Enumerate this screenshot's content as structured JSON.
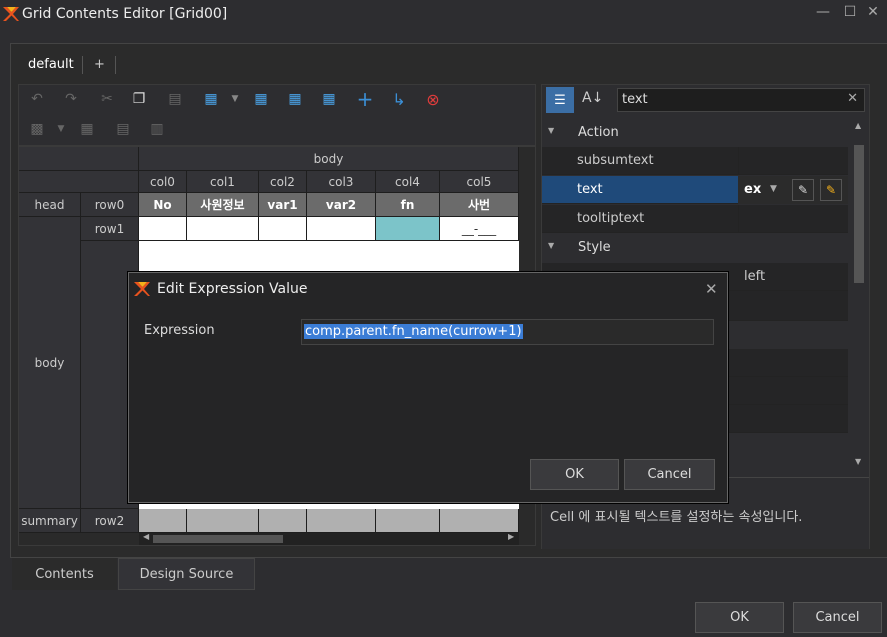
{
  "window": {
    "title": "Grid Contents Editor [Grid00]",
    "min_icon": "minimize-icon",
    "max_icon": "maximize-icon",
    "close_icon": "close-icon"
  },
  "tabs": {
    "active": "default",
    "add": "+"
  },
  "grid": {
    "band_body": "body",
    "columns": [
      "col0",
      "col1",
      "col2",
      "col3",
      "col4",
      "col5"
    ],
    "head_label": "head",
    "row0": "row0",
    "head_cells": [
      "No",
      "사원정보",
      "var1",
      "var2",
      "fn",
      "사번"
    ],
    "row1": "row1",
    "body_label": "body",
    "row1_col5": "__-___",
    "summary_label": "summary",
    "row2": "row2"
  },
  "props": {
    "search": "text",
    "category_action": "Action",
    "items": [
      {
        "name": "subsumtext",
        "value": ""
      },
      {
        "name": "text",
        "value": "ex"
      },
      {
        "name": "tooltiptext",
        "value": ""
      }
    ],
    "category_style": "Style",
    "style_value": "left",
    "description": "Cell 에 표시될 텍스트를 설정하는 속성입니다."
  },
  "bottom_tabs": [
    "Contents",
    "Design Source"
  ],
  "footer": {
    "ok": "OK",
    "cancel": "Cancel"
  },
  "dialog": {
    "title": "Edit Expression Value",
    "label": "Expression",
    "value": "comp.parent.fn_name(currow+1)",
    "ok": "OK",
    "cancel": "Cancel"
  },
  "colors": {
    "selected_cell": "#7cc4c9",
    "selected_row": "#1f4a7a",
    "accent": "#3b8fd6"
  }
}
